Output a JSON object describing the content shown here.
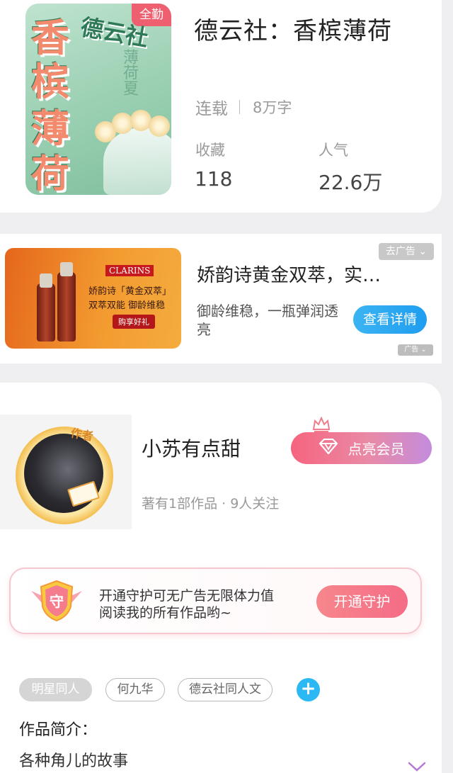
{
  "book": {
    "cover": {
      "badge": "全勤",
      "title_top": "德云社",
      "title_chars": [
        "香",
        "槟",
        "薄",
        "荷"
      ],
      "subtitle": "薄荷夏"
    },
    "title": "德云社：香槟薄荷",
    "status": "连载",
    "word_count": "8万字",
    "favorites_label": "收藏",
    "favorites_value": "118",
    "popularity_label": "人气",
    "popularity_value": "22.6万"
  },
  "ad": {
    "goto_label": "去广告",
    "image": {
      "brand": "CLARINS",
      "line1": "娇韵诗「黄金双萃」",
      "line2": "双萃双能  御龄维稳",
      "buy": "购享好礼"
    },
    "title": "娇韵诗黄金双萃，实…",
    "description": "御龄维稳，一瓶弹润透亮",
    "detail_button": "查看详情",
    "ad_mark": "广告"
  },
  "author": {
    "avatar_tag": "作者",
    "name": "小苏有点甜",
    "stats": "著有1部作品 · 9人关注",
    "vip_button": "点亮会员",
    "guard": {
      "icon_char": "守",
      "line1": "开通守护可无广告无限体力值",
      "line2": "阅读我的所有作品哟~",
      "button": "开通守护"
    },
    "tags": [
      "明星同人",
      "何九华",
      "德云社同人文"
    ],
    "intro_label": "作品简介：",
    "intro_text": "各种角儿的故事"
  },
  "colors": {
    "ad_button": "#1f9df0",
    "vip_gradient_start": "#f6647e",
    "vip_gradient_end": "#c48cde",
    "guard_button": "#f56c86",
    "tag_add": "#2bb8f3"
  },
  "icons": [
    "diamond-icon",
    "crown-icon",
    "shield-icon",
    "plus-icon",
    "chevron-down-icon",
    "chevron-down-small-icon"
  ]
}
